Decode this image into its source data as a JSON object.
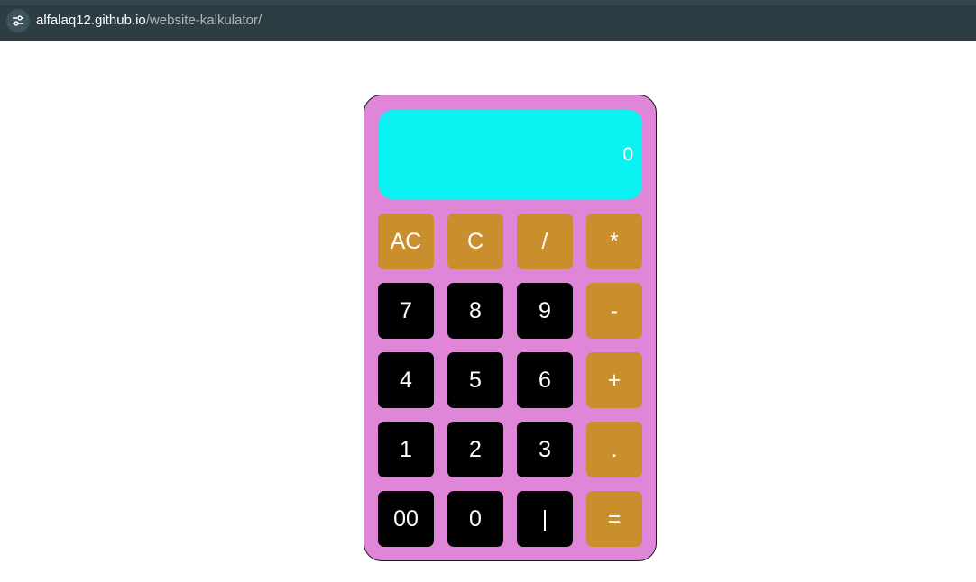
{
  "browser": {
    "url_host": "alfalaq12.github.io",
    "url_path": "/website-kalkulator/",
    "site_info_icon": "tune-icon"
  },
  "calculator": {
    "display_value": "0",
    "colors": {
      "body": "#e086d9",
      "display": "#0bf2f2",
      "number_key": "#000000",
      "operator_key": "#c98f2d"
    },
    "keys": [
      {
        "label": "AC",
        "type": "op",
        "name": "all-clear-button"
      },
      {
        "label": "C",
        "type": "op",
        "name": "clear-button"
      },
      {
        "label": "/",
        "type": "op",
        "name": "divide-button"
      },
      {
        "label": "*",
        "type": "op",
        "name": "multiply-button"
      },
      {
        "label": "7",
        "type": "num",
        "name": "digit-7-button"
      },
      {
        "label": "8",
        "type": "num",
        "name": "digit-8-button"
      },
      {
        "label": "9",
        "type": "num",
        "name": "digit-9-button"
      },
      {
        "label": "-",
        "type": "op",
        "name": "subtract-button"
      },
      {
        "label": "4",
        "type": "num",
        "name": "digit-4-button"
      },
      {
        "label": "5",
        "type": "num",
        "name": "digit-5-button"
      },
      {
        "label": "6",
        "type": "num",
        "name": "digit-6-button"
      },
      {
        "label": "+",
        "type": "op",
        "name": "add-button"
      },
      {
        "label": "1",
        "type": "num",
        "name": "digit-1-button"
      },
      {
        "label": "2",
        "type": "num",
        "name": "digit-2-button"
      },
      {
        "label": "3",
        "type": "num",
        "name": "digit-3-button"
      },
      {
        "label": ".",
        "type": "op",
        "name": "decimal-button"
      },
      {
        "label": "00",
        "type": "num",
        "name": "double-zero-button"
      },
      {
        "label": "0",
        "type": "num",
        "name": "digit-0-button"
      },
      {
        "label": "|",
        "type": "num",
        "name": "pipe-button"
      },
      {
        "label": "=",
        "type": "op",
        "name": "equals-button"
      }
    ]
  }
}
